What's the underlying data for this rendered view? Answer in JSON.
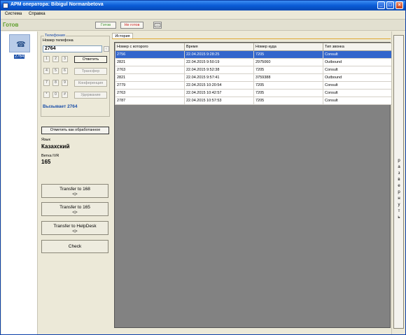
{
  "window": {
    "title": "АРМ оператора: Bibigul Normanbetova"
  },
  "menu": {
    "items": [
      "Система",
      "Справка"
    ]
  },
  "status": {
    "text": "Готов",
    "ready_label": "Готов",
    "not_ready_label": "Не готов"
  },
  "nav": {
    "tile_label": "2764"
  },
  "phone": {
    "group_title": "Телефония",
    "number_label": "Номер телефона",
    "number_value": "2764",
    "keys": [
      "1",
      "2",
      "3",
      "4",
      "5",
      "6",
      "7",
      "8",
      "9",
      "*",
      "0",
      "#"
    ],
    "answer_label": "Ответить",
    "transfer_label": "Трансфер",
    "conference_label": "Конференция",
    "hold_label": "Удержание",
    "calling_text": "Вызывает 2764"
  },
  "actions": {
    "mark_processed": "Отметить как обработанное"
  },
  "info": {
    "language_label": "Язык",
    "language_value": "Казахский",
    "ivr_label": "Ветка IVR",
    "ivr_value": "165"
  },
  "transfer_buttons": [
    {
      "label": "Transfer to 168",
      "arrows": "<|>"
    },
    {
      "label": "Transfer to 165",
      "arrows": "<|>"
    },
    {
      "label": "Transfer to HelpDesk",
      "arrows": "<|>"
    }
  ],
  "check_label": "Check",
  "history": {
    "tab_label": "История",
    "columns": [
      "Номер с которого",
      "Время",
      "Номер куда",
      "Тип звонка"
    ],
    "rows": [
      [
        "2756",
        "22.04.2015 9:28:25",
        "7205",
        "Consult"
      ],
      [
        "2821",
        "22.04.2015 9:50:19",
        "2975060",
        "Outbound"
      ],
      [
        "2763",
        "22.04.2015 9:52:38",
        "7205",
        "Consult"
      ],
      [
        "2821",
        "22.04.2015 9:57:41",
        "3759388",
        "Outbound"
      ],
      [
        "2779",
        "22.04.2015 10:20:54",
        "7205",
        "Consult"
      ],
      [
        "2763",
        "22.04.2015 10:42:57",
        "7205",
        "Consult"
      ],
      [
        "2787",
        "22.04.2015 10:57:53",
        "7205",
        "Consult"
      ]
    ],
    "selected_row": 0
  },
  "expand": {
    "letters": [
      "р",
      "а",
      "з",
      "в",
      "е",
      "р",
      "н",
      "у",
      "т",
      "ь"
    ]
  },
  "colors": {
    "accent": "#3366cc",
    "status_green": "#5f9f2d",
    "not_ready_red": "#cc2222"
  }
}
